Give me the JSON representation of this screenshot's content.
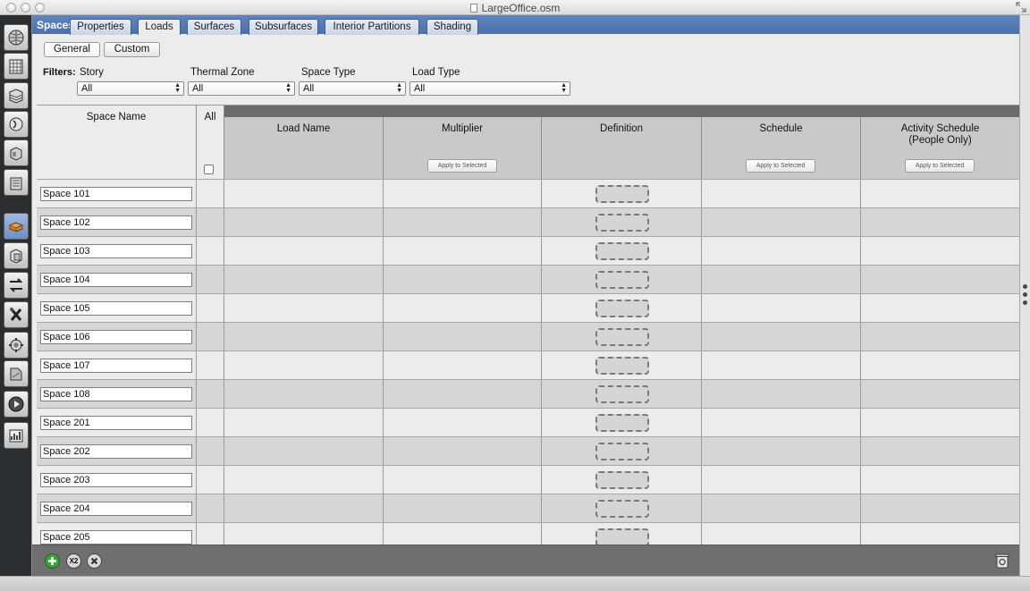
{
  "window": {
    "title": "LargeOffice.osm"
  },
  "sidebar": {
    "icons": [
      "site-icon",
      "schedules-icon",
      "constructions-icon",
      "loads-icon",
      "space-types-icon",
      "geometry-icon",
      "spaces-icon",
      "thermal-zones-icon",
      "hvac-systems-icon",
      "building-summary-icon",
      "outputs-icon",
      "simulation-settings-icon",
      "scripts-icon",
      "run-icon",
      "results-icon"
    ],
    "active_index": 6
  },
  "tabbar": {
    "section_label": "Spaces",
    "tabs": [
      "Properties",
      "Loads",
      "Surfaces",
      "Subsurfaces",
      "Interior Partitions",
      "Shading"
    ],
    "active_tab": "Loads"
  },
  "subtabs": {
    "items": [
      "General",
      "Custom"
    ],
    "active": "General"
  },
  "filters": {
    "label": "Filters:",
    "items": [
      {
        "label": "Story",
        "value": "All"
      },
      {
        "label": "Thermal Zone",
        "value": "All"
      },
      {
        "label": "Space Type",
        "value": "All"
      },
      {
        "label": "Load Type",
        "value": "All"
      }
    ]
  },
  "grid": {
    "columns": {
      "space_name": "Space Name",
      "all": "All",
      "load_name": "Load Name",
      "multiplier": "Multiplier",
      "definition": "Definition",
      "schedule": "Schedule",
      "activity_schedule_line1": "Activity Schedule",
      "activity_schedule_line2": "(People Only)"
    },
    "apply_label": "Apply to Selected",
    "rows": [
      "Space 101",
      "Space 102",
      "Space 103",
      "Space 104",
      "Space 105",
      "Space 106",
      "Space 107",
      "Space 108",
      "Space 201",
      "Space 202",
      "Space 203",
      "Space 204",
      "Space 205"
    ]
  },
  "bottombar": {
    "add_icon": "add-icon",
    "copy_label": "X2",
    "remove_icon": "remove-icon",
    "purge_icon": "purge-icon"
  }
}
